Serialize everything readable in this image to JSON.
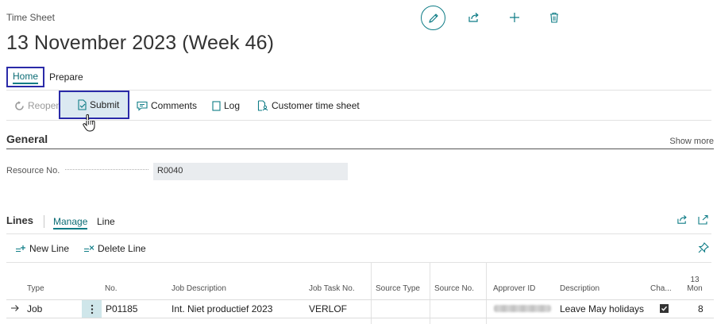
{
  "page": {
    "caption": "Time Sheet",
    "title": "13 November 2023 (Week 46)"
  },
  "header_actions": [
    {
      "name": "edit",
      "icon": "pencil-icon"
    },
    {
      "name": "share",
      "icon": "share-icon"
    },
    {
      "name": "new",
      "icon": "plus-icon"
    },
    {
      "name": "delete",
      "icon": "trash-icon"
    }
  ],
  "menu": {
    "tabs": [
      "Home",
      "Prepare"
    ],
    "selected": "Home"
  },
  "actions": {
    "reopen": "Reopen",
    "submit": "Submit",
    "comments": "Comments",
    "log": "Log",
    "customer_time_sheet": "Customer time sheet"
  },
  "general": {
    "title": "General",
    "show_more": "Show more",
    "resource_label": "Resource No.",
    "resource_value": "R0040"
  },
  "lines": {
    "title": "Lines",
    "tabs": [
      "Manage",
      "Line"
    ],
    "new_line": "New Line",
    "delete_line": "Delete Line",
    "columns": {
      "type": "Type",
      "no": "No.",
      "job_description": "Job Description",
      "job_task_no": "Job Task No.",
      "source_type": "Source Type",
      "source_no": "Source No.",
      "approver_id": "Approver ID",
      "description": "Description",
      "chargeable": "Cha...",
      "day_number": "13",
      "day_name": "Mon"
    },
    "rows": [
      {
        "type": "Job",
        "no": "P01185",
        "job_description": "Int. Niet productief 2023",
        "job_task_no": "VERLOF",
        "source_type": "",
        "source_no": "",
        "approver_id": "",
        "description": "Leave May holidays",
        "chargeable": true,
        "mon": "8"
      }
    ]
  },
  "colors": {
    "accent": "#0e7c86",
    "highlight_border": "#2a2aa8",
    "highlight_fill": "#dbe9f1"
  }
}
